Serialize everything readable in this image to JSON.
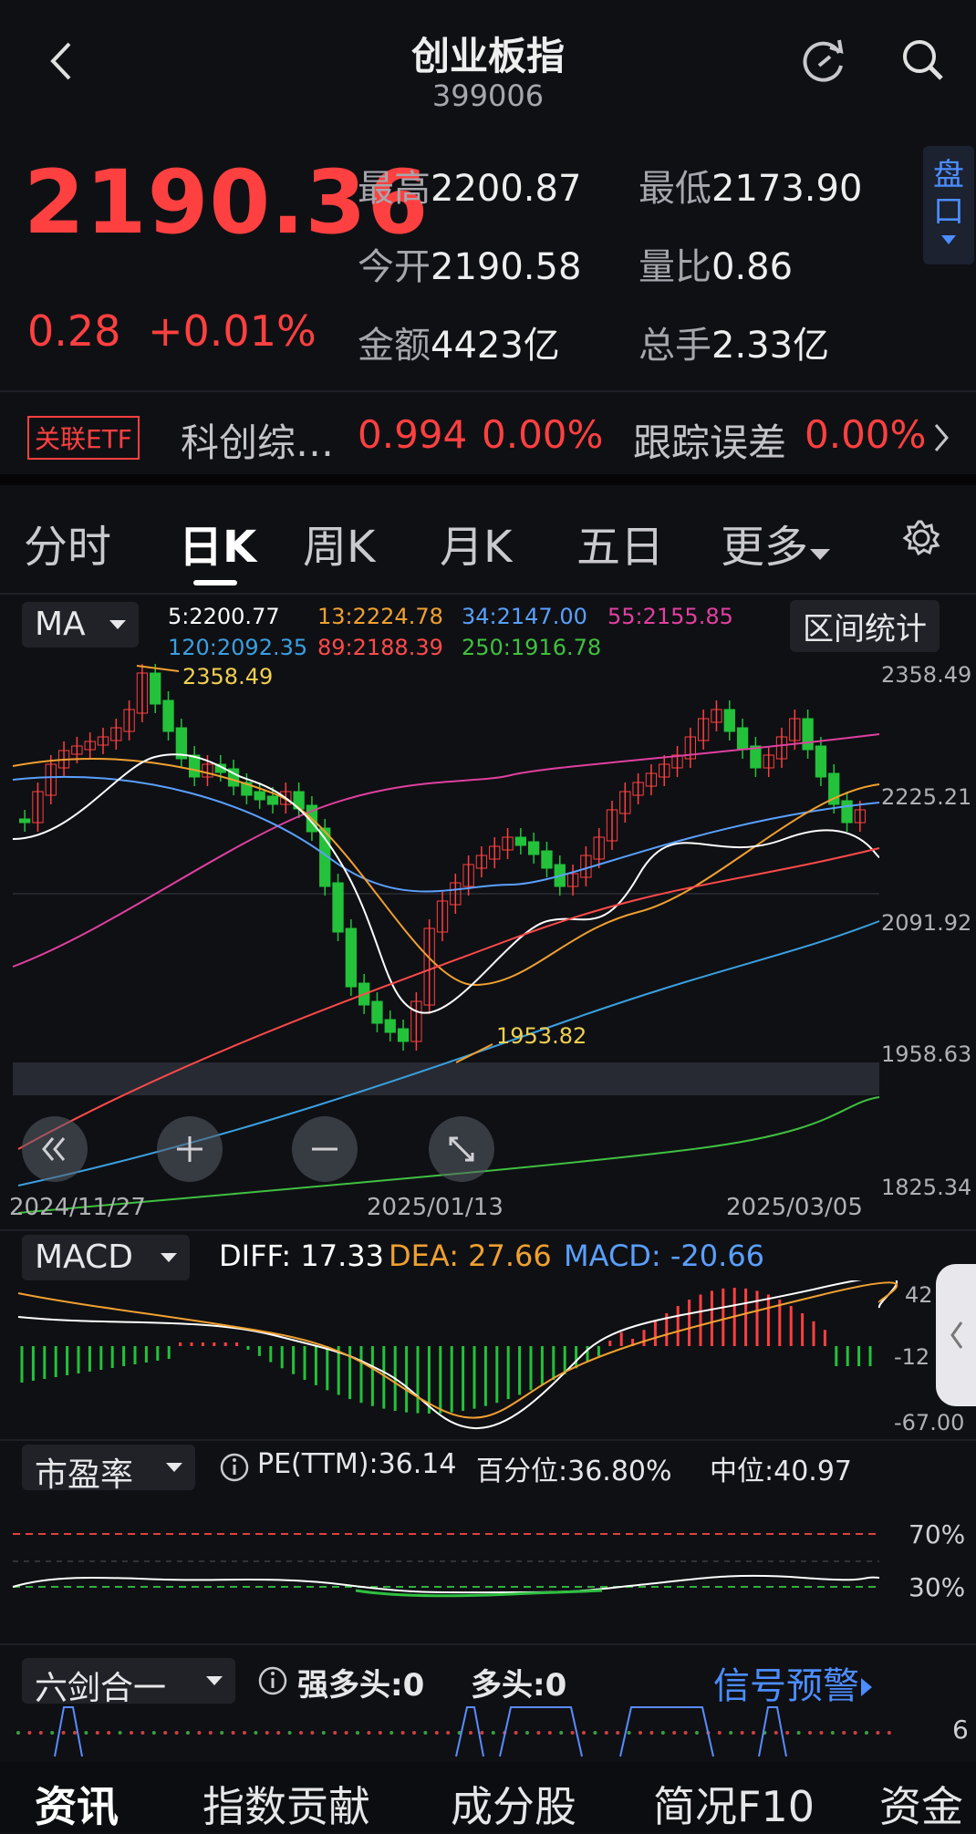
{
  "header": {
    "title": "创业板指",
    "code": "399006"
  },
  "quote": {
    "price": "2190.36",
    "change": "0.28",
    "change_pct": "+0.01%",
    "stats": [
      {
        "label": "最高",
        "value": "2200.87"
      },
      {
        "label": "最低",
        "value": "2173.90"
      },
      {
        "label": "今开",
        "value": "2190.58"
      },
      {
        "label": "量比",
        "value": "0.86"
      },
      {
        "label": "金额",
        "value": "4423亿"
      },
      {
        "label": "总手",
        "value": "2.33亿"
      }
    ],
    "side_button": "盘口"
  },
  "etf": {
    "badge": "关联ETF",
    "name": "科创综…",
    "price": "0.994",
    "pct": "0.00%",
    "tracking_label": "跟踪误差",
    "tracking_value": "0.00%"
  },
  "tabs": [
    "分时",
    "日K",
    "周K",
    "月K",
    "五日",
    "更多"
  ],
  "active_tab": "日K",
  "ma": {
    "selector": "MA",
    "range_button": "区间统计",
    "legend": [
      {
        "text": "5:2200.77",
        "color": "#ffffff"
      },
      {
        "text": "13:2224.78",
        "color": "#f0a030"
      },
      {
        "text": "34:2147.00",
        "color": "#5aa0ff"
      },
      {
        "text": "55:2155.85",
        "color": "#e040a0"
      },
      {
        "text": "120:2092.35",
        "color": "#3aa0e0"
      },
      {
        "text": "89:2188.39",
        "color": "#ff4a4a"
      },
      {
        "text": "250:1916.78",
        "color": "#40c040"
      }
    ],
    "y_ticks": [
      "2358.49",
      "2225.21",
      "2091.92",
      "1958.63",
      "1825.34"
    ],
    "x_ticks": [
      "2024/11/27",
      "2025/01/13",
      "2025/03/05"
    ],
    "high_marker": "2358.49",
    "low_marker": "1953.82"
  },
  "macd": {
    "selector": "MACD",
    "diff_label": "DIFF: 17.33",
    "dea_label": "DEA: 27.66",
    "macd_label": "MACD: -20.66",
    "y_ticks": [
      "42",
      "-12",
      "-67.00"
    ]
  },
  "pe": {
    "selector": "市盈率",
    "pe_label": "PE(TTM):36.14",
    "pct_label": "百分位:36.80%",
    "median_label": "中位:40.97",
    "y_ticks": [
      "70%",
      "30%"
    ]
  },
  "six": {
    "selector": "六剑合一",
    "strong_label": "强多头:0",
    "long_label": "多头:0",
    "signal_link": "信号预警",
    "y_tick": "6"
  },
  "bottom_nav": [
    "资讯",
    "指数贡献",
    "成分股",
    "简况F10",
    "资金"
  ],
  "colors": {
    "up": "#ff4040",
    "down": "#23c23a",
    "bg": "#0f1014"
  }
}
